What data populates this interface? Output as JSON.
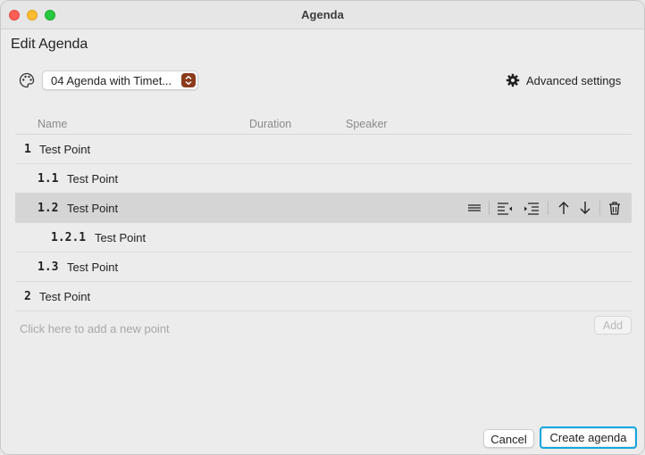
{
  "window": {
    "title": "Agenda"
  },
  "heading": "Edit Agenda",
  "template": {
    "selected": "04 Agenda with Timet...",
    "icon": "palette-icon"
  },
  "advanced_settings": {
    "label": "Advanced settings",
    "icon": "gear-icon"
  },
  "columns": [
    "Name",
    "Duration",
    "Speaker"
  ],
  "points": [
    {
      "number": "1",
      "title": "Test Point",
      "level": 0
    },
    {
      "number": "1.1",
      "title": "Test Point",
      "level": 1
    },
    {
      "number": "1.2",
      "title": "Test Point",
      "level": 1,
      "selected": true
    },
    {
      "number": "1.2.1",
      "title": "Test Point",
      "level": 2
    },
    {
      "number": "1.3",
      "title": "Test Point",
      "level": 1
    },
    {
      "number": "2",
      "title": "Test Point",
      "level": 0
    }
  ],
  "row_tools": [
    "drag-handle-icon",
    "outdent-icon",
    "indent-icon",
    "move-up-icon",
    "move-down-icon",
    "trash-icon"
  ],
  "new_point": {
    "placeholder": "Click here to add a new point",
    "add_label": "Add"
  },
  "footer": {
    "cancel_label": "Cancel",
    "create_label": "Create agenda"
  },
  "colors": {
    "selection": "#d5d5d5",
    "focus_ring": "#13a7e0",
    "stepper": "#8b3a1a"
  }
}
